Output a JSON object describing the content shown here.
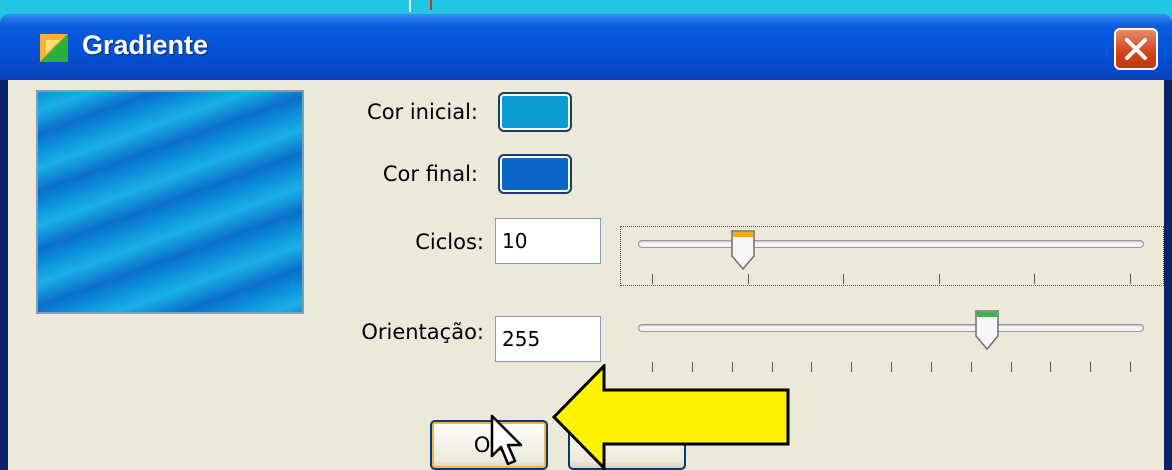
{
  "window": {
    "title": "Gradiente",
    "title_icon": "gradient-app-icon",
    "close_icon": "close-icon"
  },
  "form": {
    "cor_inicial_label": "Cor inicial:",
    "cor_inicial_color": "#0b9bd3",
    "cor_final_label": "Cor final:",
    "cor_final_color": "#0a66c8",
    "ciclos_label": "Ciclos:",
    "ciclos_value": "10",
    "ciclos_slider_fraction": 0.19,
    "orientacao_label": "Orientação:",
    "orientacao_value": "255",
    "orientacao_slider_fraction": 0.7
  },
  "buttons": {
    "ok_label": "OK"
  },
  "colors": {
    "background": "#1fc3e0",
    "titlebar": "#0552d6",
    "dialog": "#ece9d8",
    "arrow": "#fff200",
    "close_button": "#d2421a"
  }
}
